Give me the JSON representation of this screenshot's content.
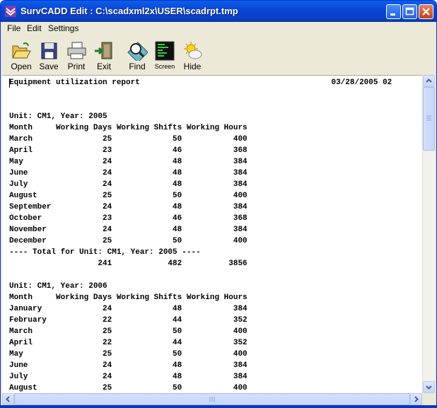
{
  "window": {
    "title": "SurvCADD Edit : C:\\scadxml2x\\USER\\scadrpt.tmp"
  },
  "menu": [
    {
      "label": "File",
      "name": "menu-file"
    },
    {
      "label": "Edit",
      "name": "menu-edit"
    },
    {
      "label": "Settings",
      "name": "menu-settings"
    }
  ],
  "toolbar": {
    "open_label": "Open",
    "save_label": "Save",
    "print_label": "Print",
    "exit_label": "Exit",
    "find_label": "Find",
    "screen_label": "Screen",
    "hide_label": "Hide"
  },
  "document": {
    "text": "Equipment utilization report                                         03/28/2005 02\n\n\nUnit: CM1, Year: 2005\nMonth     Working Days Working Shifts Working Hours\nMarch               25             50           400\nApril               23             46           368\nMay                 24             48           384\nJune                24             48           384\nJuly                24             48           384\nAugust              25             50           400\nSeptember           24             48           384\nOctober             23             46           368\nNovember            24             48           384\nDecember            25             50           400\n---- Total for Unit: CM1, Year: 2005 ----\n                   241            482          3856\n\nUnit: CM1, Year: 2006\nMonth     Working Days Working Shifts Working Hours\nJanuary             24             48           384\nFebruary            22             44           352\nMarch               25             50           400\nApril               22             44           352\nMay                 25             50           400\nJune                24             48           384\nJuly                24             48           384\nAugust              25             50           400"
  },
  "scrollbars": {
    "vertical_position": 0.0,
    "horizontal_position": 0.0
  },
  "colors": {
    "titlebar": "#0a46d6",
    "window_bg": "#ece9d8",
    "text": "#000000"
  }
}
